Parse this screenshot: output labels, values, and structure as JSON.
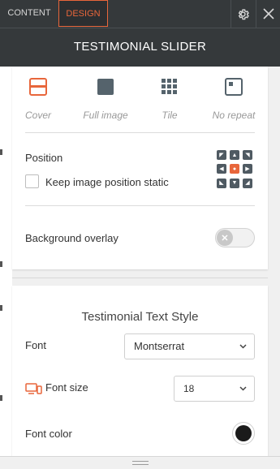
{
  "tabs": {
    "content": "CONTENT",
    "design": "DESIGN"
  },
  "header": {
    "title": "TESTIMONIAL SLIDER"
  },
  "background_fill": {
    "options": [
      {
        "label": "Cover",
        "icon": "cover-icon",
        "active": true
      },
      {
        "label": "Full image",
        "icon": "full-image-icon",
        "active": false
      },
      {
        "label": "Tile",
        "icon": "tile-icon",
        "active": false
      },
      {
        "label": "No repeat",
        "icon": "no-repeat-icon",
        "active": false
      }
    ]
  },
  "position": {
    "label": "Position",
    "selected": "center",
    "keep_static_label": "Keep image position static",
    "keep_static_checked": false
  },
  "background_overlay": {
    "label": "Background overlay",
    "enabled": false
  },
  "text_style": {
    "title": "Testimonial Text Style",
    "font_label": "Font",
    "font_value": "Montserrat",
    "font_size_label": "Font size",
    "font_size_value": "18",
    "font_color_label": "Font color",
    "font_color_value": "#1a1a1a"
  },
  "colors": {
    "accent": "#e8663b",
    "header_bg": "#35393b",
    "control_dark": "#4f5a62"
  }
}
